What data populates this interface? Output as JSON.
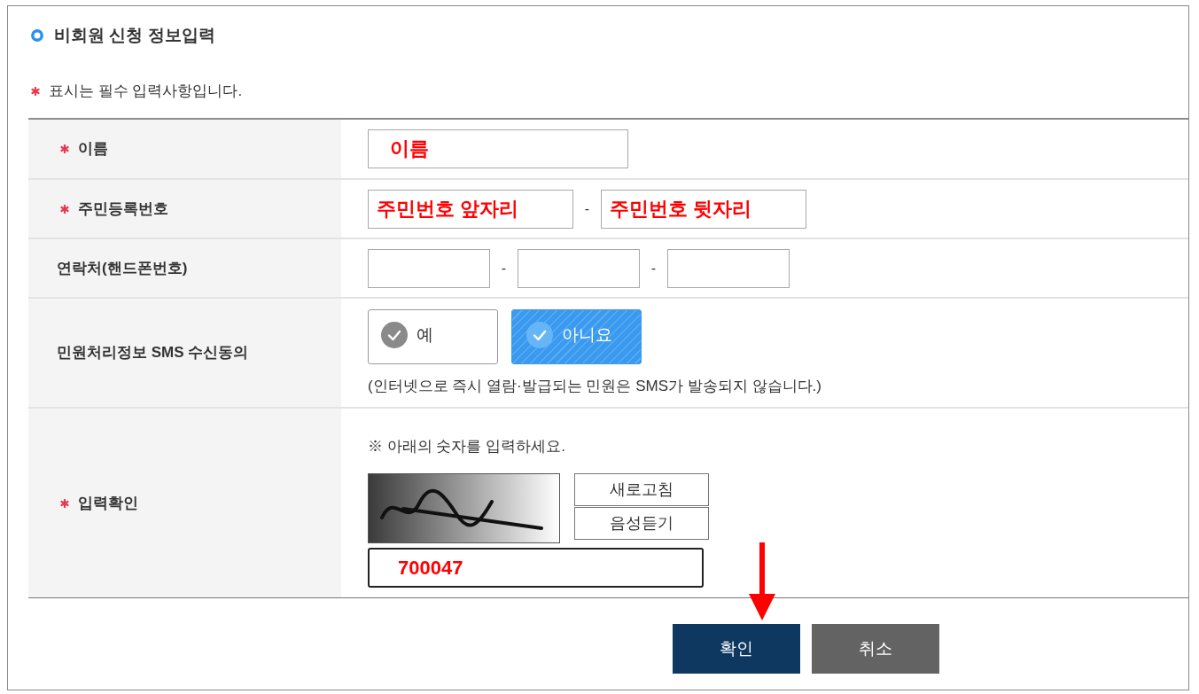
{
  "title": "비회원 신청 정보입력",
  "notice": "표시는 필수 입력사항입니다.",
  "form": {
    "rows": [
      {
        "kind": "text",
        "label": "이름",
        "required": true,
        "parts": [
          {
            "kind": "input",
            "value": "이름"
          }
        ]
      },
      {
        "kind": "split",
        "label": "주민등록번호",
        "required": true,
        "parts": [
          {
            "kind": "input",
            "value": "주민번호 앞자리"
          },
          {
            "kind": "separator",
            "text": "-"
          },
          {
            "kind": "input",
            "value": "주민번호 뒷자리"
          }
        ]
      },
      {
        "kind": "split",
        "label": "연락처(핸드폰번호)",
        "required": false,
        "parts": [
          {
            "kind": "input"
          },
          {
            "kind": "separator",
            "text": "-"
          },
          {
            "kind": "input"
          },
          {
            "kind": "separator",
            "text": "-"
          },
          {
            "kind": "input"
          }
        ]
      },
      {
        "kind": "choice",
        "label": "민원처리정보 SMS 수신동의",
        "required": false,
        "options": [
          {
            "label": "예",
            "selected": false
          },
          {
            "label": "아니요",
            "selected": true
          }
        ],
        "note": "(인터넷으로 즉시 열람·발급되는 민원은 SMS가 발송되지 않습니다.)"
      },
      {
        "kind": "captcha",
        "label": "입력확인",
        "required": true,
        "hint": "※ 아래의 숫자를 입력하세요.",
        "buttons": [
          "새로고침",
          "음성듣기"
        ],
        "value": "700047"
      }
    ]
  },
  "buttons": [
    {
      "label": "확인",
      "kind": "primary"
    },
    {
      "label": "취소",
      "kind": "secondary"
    }
  ]
}
